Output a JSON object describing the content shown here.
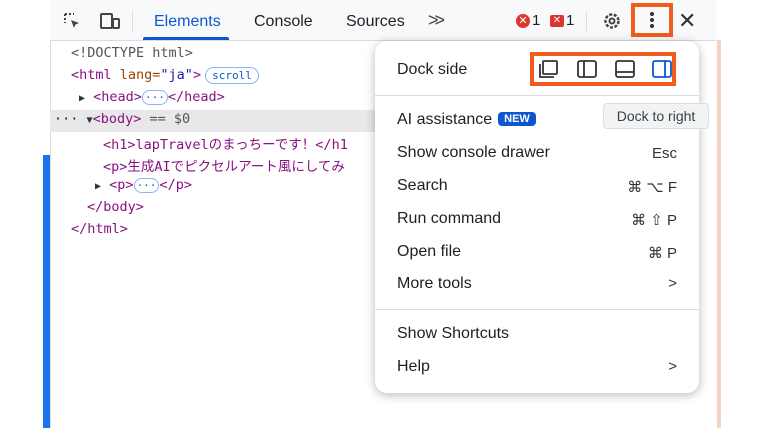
{
  "toolbar": {
    "tabs": [
      "Elements",
      "Console",
      "Sources"
    ],
    "more_tabs": ">>",
    "errors_count": "1",
    "issues_count": "1"
  },
  "dom": {
    "doctype": "<!DOCTYPE html>",
    "html_open": "<html",
    "html_attr": " lang=",
    "html_lang": "\"ja\"",
    "html_close_bracket": ">",
    "scroll_badge": "scroll",
    "head_open": "<head>",
    "ellipsis": "···",
    "head_close": "</head>",
    "row_dots": "···",
    "body_open": "<body>",
    "body_eq": " == $0",
    "h1_line": "<h1>lapTravelのまっちーです！</h1",
    "p1_line": "<p>生成AIでピクセルアート風にしてみ",
    "p2_open": "<p>",
    "p2_close": "</p>",
    "body_close": "</body>",
    "html_end": "</html>"
  },
  "menu": {
    "dock_side_label": "Dock side",
    "dock_options": [
      "undock-icon",
      "dock-left-icon",
      "dock-bottom-icon",
      "dock-right-icon"
    ],
    "items": [
      {
        "label": "AI assistance",
        "badge": "NEW",
        "shortcut": ""
      },
      {
        "label": "Show console drawer",
        "shortcut": "Esc"
      },
      {
        "label": "Search",
        "shortcut": "⌘ ⌥ F"
      },
      {
        "label": "Run command",
        "shortcut": "⌘ ⇧ P"
      },
      {
        "label": "Open file",
        "shortcut": "⌘ P"
      },
      {
        "label": "More tools",
        "shortcut": ">"
      }
    ],
    "items2": [
      {
        "label": "Show Shortcuts",
        "shortcut": ""
      },
      {
        "label": "Help",
        "shortcut": ">"
      }
    ]
  },
  "tooltip": "Dock to right",
  "colors": {
    "highlight": "#f25c1e",
    "accent": "#0b57d0",
    "error": "#dc362e"
  }
}
